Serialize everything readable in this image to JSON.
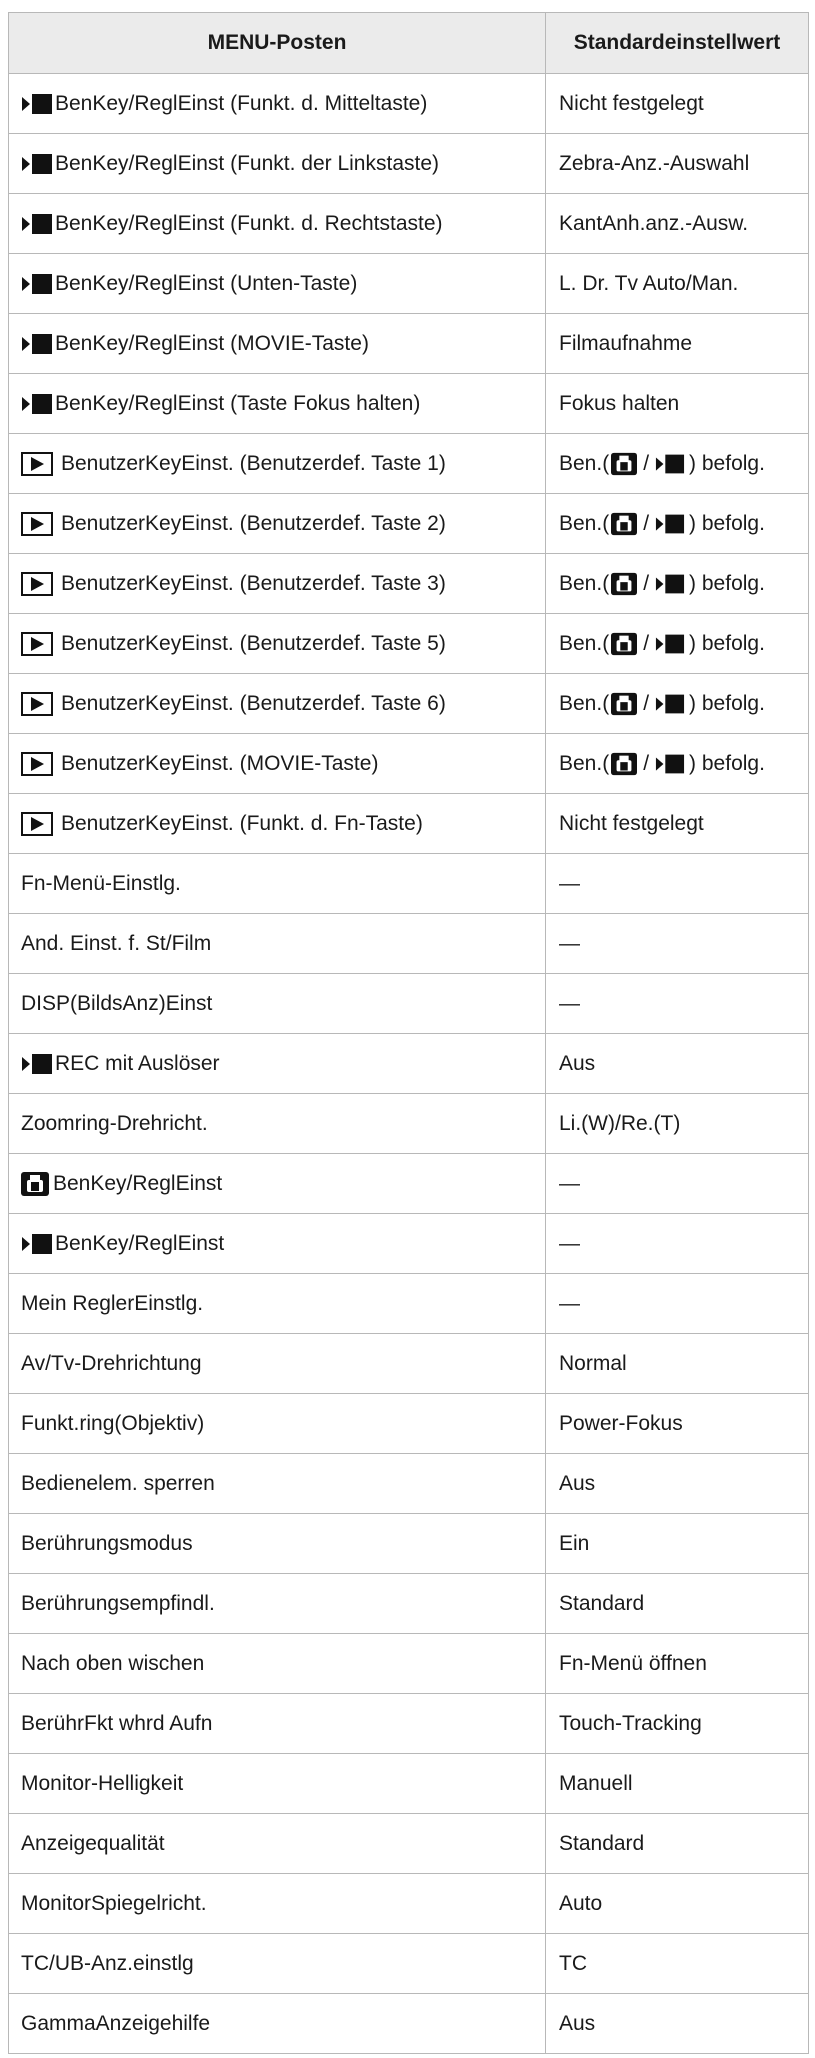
{
  "table": {
    "headers": [
      "MENU-Posten",
      "Standardeinstellwert"
    ],
    "ben_value": {
      "open": "Ben.(",
      "slash": "/",
      "close": ") befolg."
    },
    "rows": [
      {
        "icon": "movie-icon",
        "item": "BenKey/ReglEinst (Funkt. d. Mitteltaste)",
        "value": "Nicht festgelegt"
      },
      {
        "icon": "movie-icon",
        "item": "BenKey/ReglEinst (Funkt. der Linkstaste)",
        "value": "Zebra-Anz.-Auswahl"
      },
      {
        "icon": "movie-icon",
        "item": "BenKey/ReglEinst (Funkt. d. Rechtstaste)",
        "value": "KantAnh.anz.-Ausw."
      },
      {
        "icon": "movie-icon",
        "item": "BenKey/ReglEinst (Unten-Taste)",
        "value": "L. Dr. Tv Auto/Man."
      },
      {
        "icon": "movie-icon",
        "item": "BenKey/ReglEinst (MOVIE-Taste)",
        "value": "Filmaufnahme"
      },
      {
        "icon": "movie-icon",
        "item": "BenKey/ReglEinst (Taste Fokus halten)",
        "value": "Fokus halten"
      },
      {
        "icon": "playback-icon",
        "item": "BenutzerKeyEinst. (Benutzerdef. Taste 1)",
        "value": ""
      },
      {
        "icon": "playback-icon",
        "item": "BenutzerKeyEinst. (Benutzerdef. Taste 2)",
        "value": ""
      },
      {
        "icon": "playback-icon",
        "item": "BenutzerKeyEinst. (Benutzerdef. Taste 3)",
        "value": ""
      },
      {
        "icon": "playback-icon",
        "item": "BenutzerKeyEinst. (Benutzerdef. Taste 5)",
        "value": ""
      },
      {
        "icon": "playback-icon",
        "item": "BenutzerKeyEinst. (Benutzerdef. Taste 6)",
        "value": ""
      },
      {
        "icon": "playback-icon",
        "item": "BenutzerKeyEinst. (MOVIE-Taste)",
        "value": ""
      },
      {
        "icon": "playback-icon",
        "item": "BenutzerKeyEinst. (Funkt. d. Fn-Taste)",
        "value": "Nicht festgelegt"
      },
      {
        "icon": "",
        "item": "Fn-Menü-Einstlg.",
        "value": "—"
      },
      {
        "icon": "",
        "item": "And. Einst. f. St/Film",
        "value": "—"
      },
      {
        "icon": "",
        "item": "DISP(BildsAnz)Einst",
        "value": "—"
      },
      {
        "icon": "movie-icon",
        "item": "REC mit Auslöser",
        "value": "Aus"
      },
      {
        "icon": "",
        "item": "Zoomring-Drehricht.",
        "value": "Li.(W)/Re.(T)"
      },
      {
        "icon": "still-camera-icon",
        "item": "BenKey/ReglEinst",
        "value": "—"
      },
      {
        "icon": "movie-icon",
        "item": "BenKey/ReglEinst",
        "value": "—"
      },
      {
        "icon": "",
        "item": "Mein ReglerEinstlg.",
        "value": "—"
      },
      {
        "icon": "",
        "item": "Av/Tv-Drehrichtung",
        "value": "Normal"
      },
      {
        "icon": "",
        "item": "Funkt.ring(Objektiv)",
        "value": "Power-Fokus"
      },
      {
        "icon": "",
        "item": "Bedienelem. sperren",
        "value": "Aus"
      },
      {
        "icon": "",
        "item": "Berührungsmodus",
        "value": "Ein"
      },
      {
        "icon": "",
        "item": "Berührungsempfindl.",
        "value": "Standard"
      },
      {
        "icon": "",
        "item": "Nach oben wischen",
        "value": "Fn-Menü öffnen"
      },
      {
        "icon": "",
        "item": "BerührFkt whrd Aufn",
        "value": "Touch-Tracking"
      },
      {
        "icon": "",
        "item": "Monitor-Helligkeit",
        "value": "Manuell"
      },
      {
        "icon": "",
        "item": "Anzeigequalität",
        "value": "Standard"
      },
      {
        "icon": "",
        "item": "MonitorSpiegelricht.",
        "value": "Auto"
      },
      {
        "icon": "",
        "item": "TC/UB-Anz.einstlg",
        "value": "TC"
      },
      {
        "icon": "",
        "item": "GammaAnzeigehilfe",
        "value": "Aus"
      }
    ]
  }
}
